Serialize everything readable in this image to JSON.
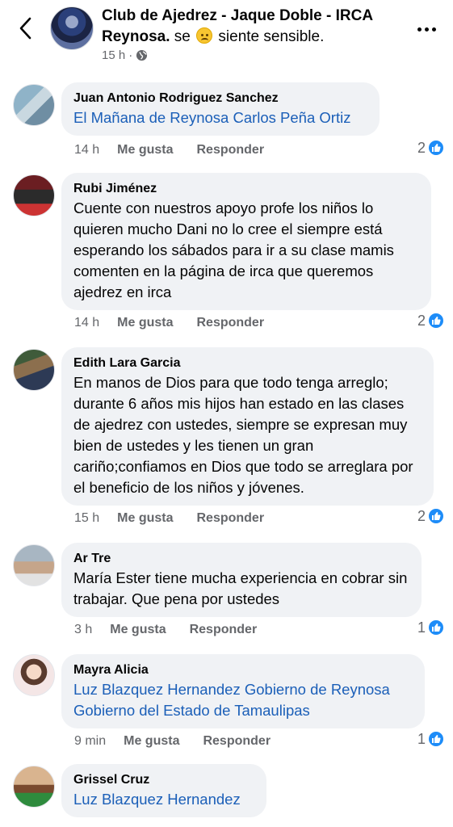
{
  "header": {
    "title_bold_1": "Club de Ajedrez - Jaque Doble - IRCA",
    "title_bold_2": "Reynosa.",
    "feeling_prefix": "se",
    "feeling_suffix": "siente sensible.",
    "time": "15 h",
    "audience_icon": "globe-icon",
    "emoji": "sad-face"
  },
  "actions_labels": {
    "like": "Me gusta",
    "reply": "Responder"
  },
  "comments": [
    {
      "name": "Juan Antonio Rodriguez Sanchez",
      "text": "El Mañana de Reynosa Carlos Peña Ortiz",
      "is_link": true,
      "time": "14 h",
      "likes": "2"
    },
    {
      "name": "Rubi Jiménez",
      "text": "Cuente con nuestros apoyo profe los niños lo quieren mucho Dani no lo cree el siempre está esperando los sábados para ir a su clase mamis comenten en la página de irca que queremos ajedrez en irca",
      "is_link": false,
      "time": "14 h",
      "likes": "2"
    },
    {
      "name": "Edith Lara Garcia",
      "text": "En manos de Dios para que todo tenga arreglo; durante 6 años mis hijos han estado en las clases de ajedrez con ustedes, siempre se expresan muy bien de ustedes y les tienen un gran cariño;confiamos en Dios que todo se arreglara por el beneficio de los niños y jóvenes.",
      "is_link": false,
      "time": "15 h",
      "likes": "2"
    },
    {
      "name": "Ar Tre",
      "text": "María Ester tiene mucha experiencia en cobrar sin trabajar. Que pena por ustedes",
      "is_link": false,
      "time": "3 h",
      "likes": "1"
    },
    {
      "name": "Mayra Alicia",
      "text": "Luz Blazquez Hernandez Gobierno de Reynosa Gobierno del Estado de Tamaulipas",
      "is_link": true,
      "time": "9 min",
      "likes": "1"
    },
    {
      "name": "Grissel Cruz",
      "text": "Luz Blazquez Hernandez",
      "is_link": true
    }
  ],
  "colors": {
    "bubble": "#f0f2f5",
    "link": "#1b5fb8",
    "like": "#1d8cf8",
    "meta": "#65676b"
  }
}
